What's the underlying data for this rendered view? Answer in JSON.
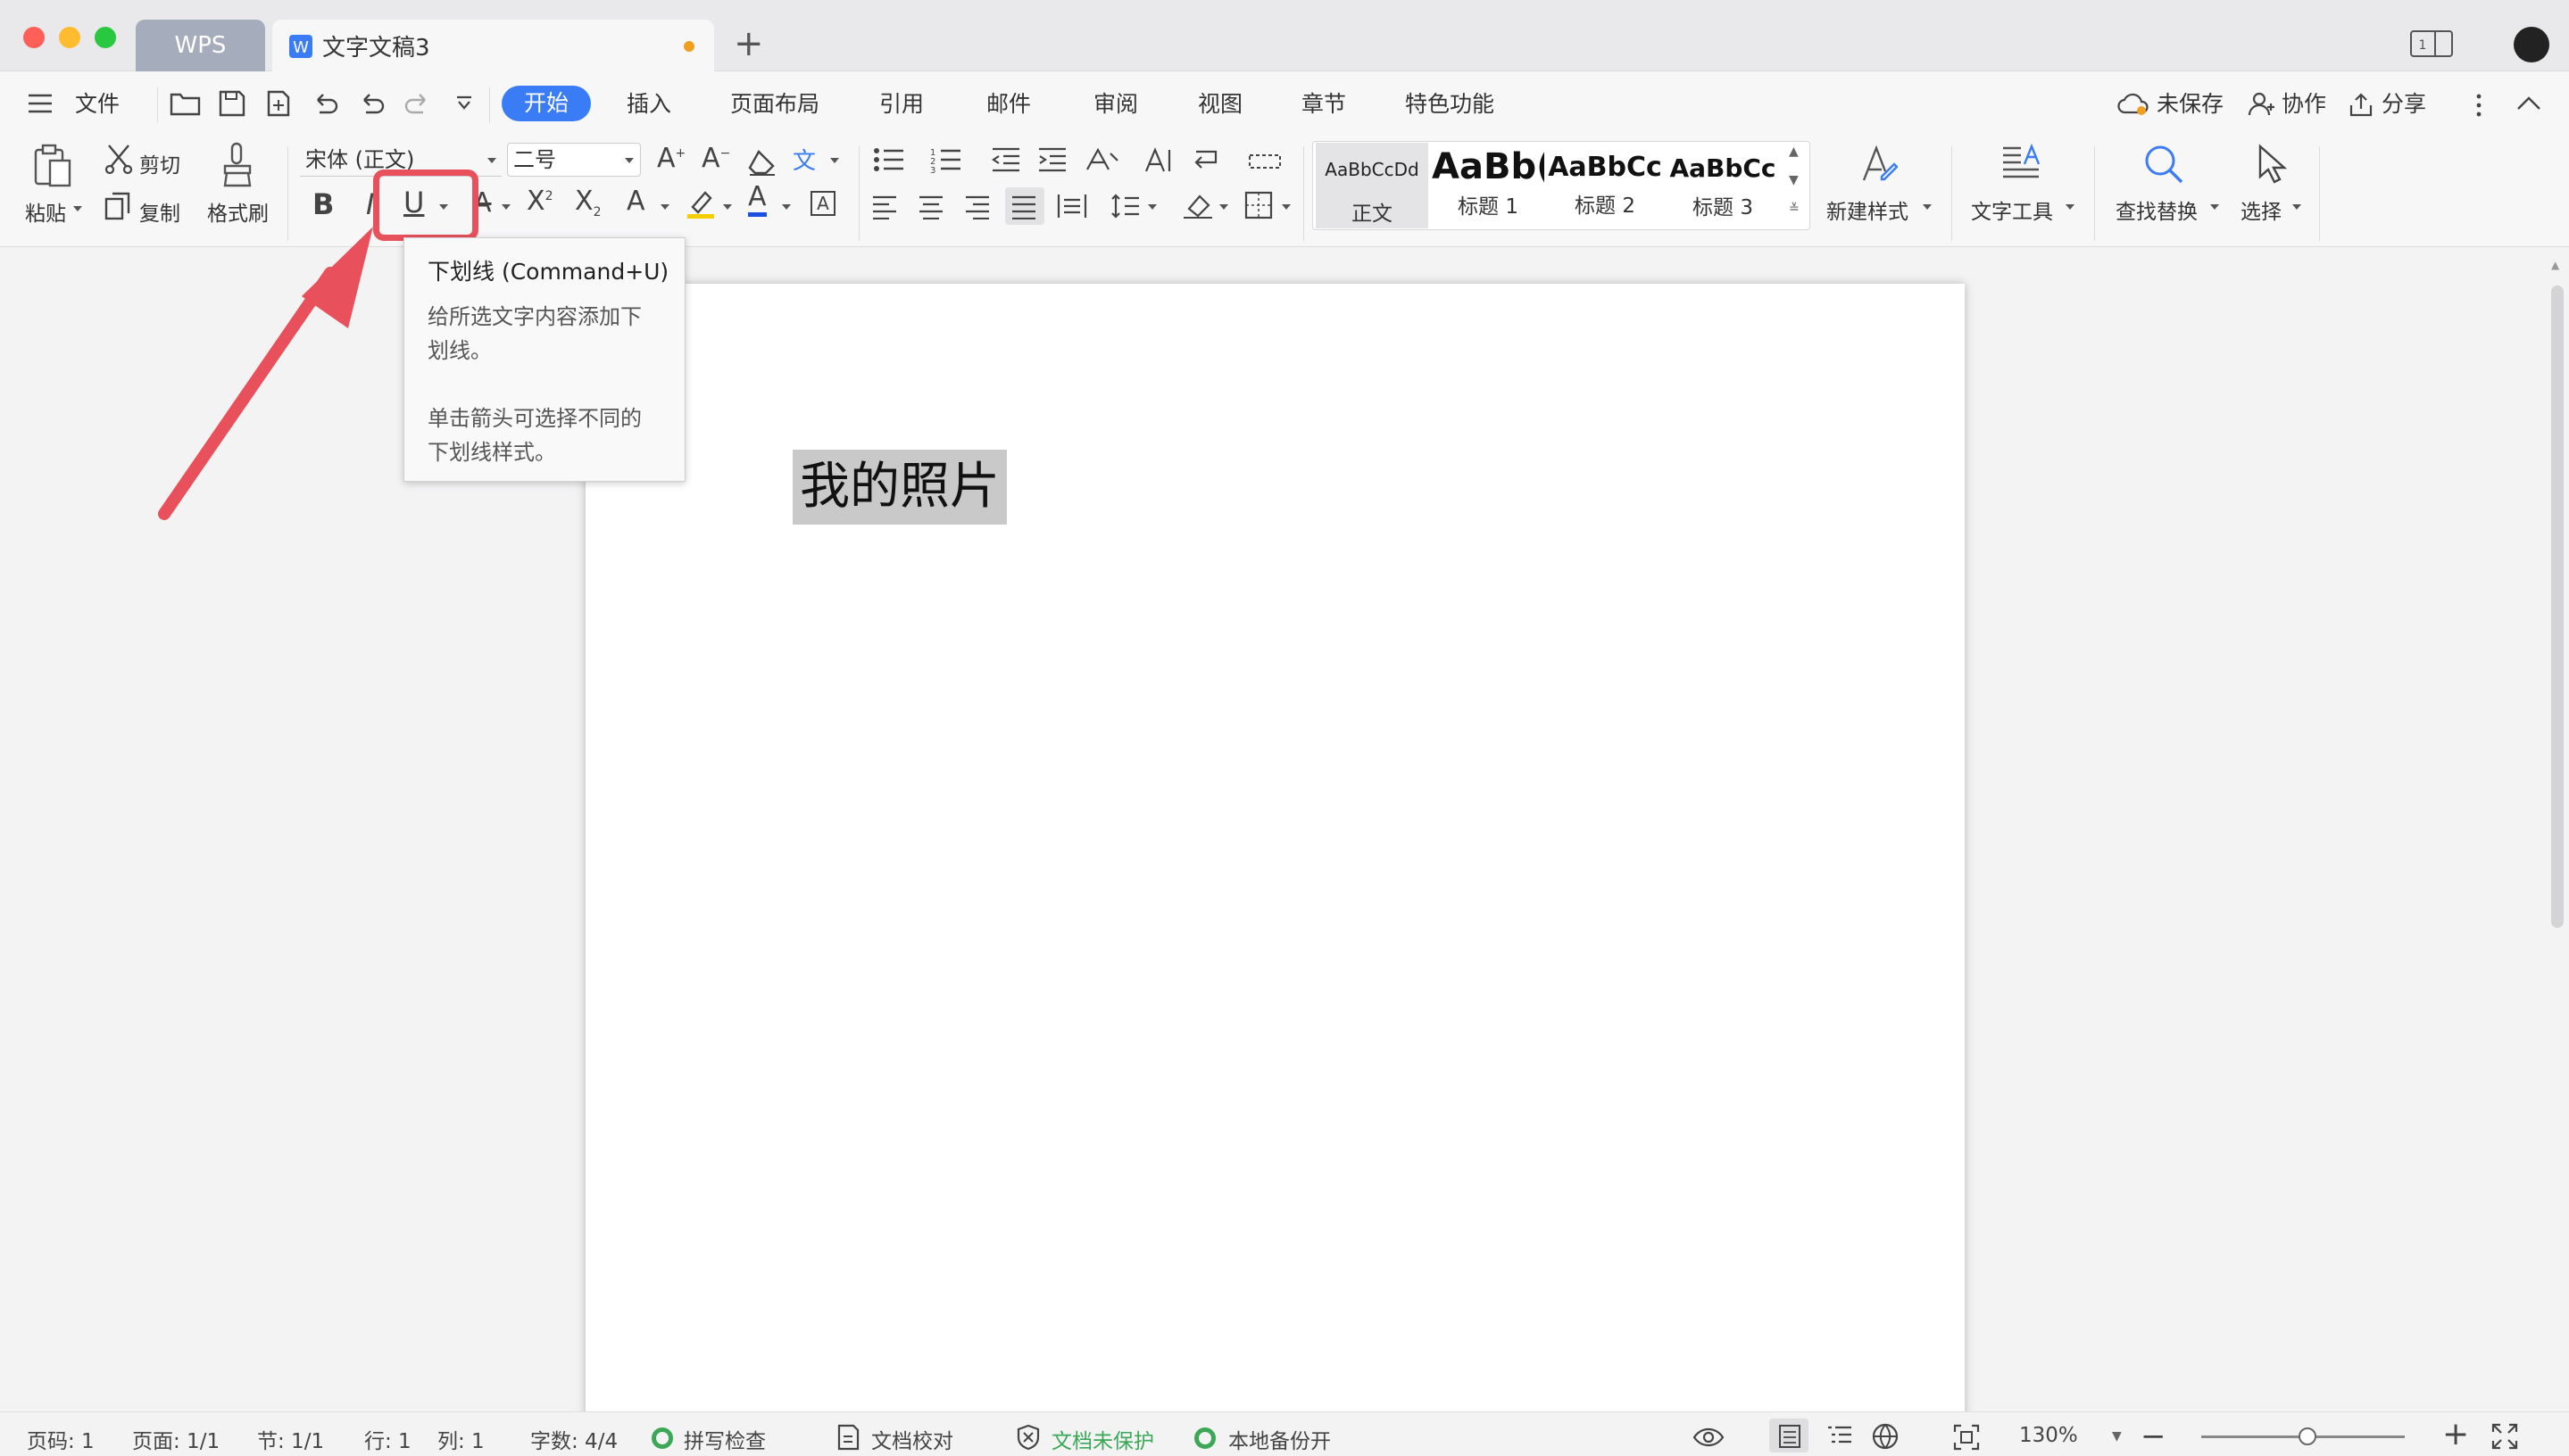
{
  "window": {
    "tabs": [
      {
        "label": "WPS"
      },
      {
        "label": "文字文稿3"
      }
    ]
  },
  "menubar": {
    "file": "文件",
    "tabs": [
      "开始",
      "插入",
      "页面布局",
      "引用",
      "邮件",
      "审阅",
      "视图",
      "章节",
      "特色功能"
    ],
    "active_tab": "开始",
    "unsaved": "未保存",
    "collab": "协作",
    "share": "分享"
  },
  "ribbon": {
    "paste": "粘贴",
    "cut": "剪切",
    "copy": "复制",
    "format_painter": "格式刷",
    "font_name": "宋体 (正文)",
    "font_size": "二号",
    "styles": [
      {
        "preview": "AaBbCcDd",
        "label": "正文"
      },
      {
        "preview": "AaBb(",
        "label": "标题 1"
      },
      {
        "preview": "AaBbCc",
        "label": "标题 2"
      },
      {
        "preview": "AaBbCc",
        "label": "标题 3"
      }
    ],
    "new_style": "新建样式",
    "text_tools": "文字工具",
    "find_replace": "查找替换",
    "select": "选择"
  },
  "tooltip": {
    "title": "下划线 (Command+U)",
    "line1": "给所选文字内容添加下",
    "line2": "划线。",
    "line3": "单击箭头可选择不同的",
    "line4": "下划线样式。"
  },
  "document": {
    "text": "我的照片"
  },
  "status": {
    "page_code": "页码: 1",
    "page": "页面: 1/1",
    "section": "节: 1/1",
    "row": "行: 1",
    "col": "列: 1",
    "word_count": "字数: 4/4",
    "spell": "拼写检查",
    "proof": "文档校对",
    "protect": "文档未保护",
    "backup": "本地备份开",
    "zoom": "130%",
    "zoom_level": 0.52
  },
  "colors": {
    "accent": "#3a7cf5",
    "highlight": "#e8505b",
    "green": "#3aa856"
  }
}
